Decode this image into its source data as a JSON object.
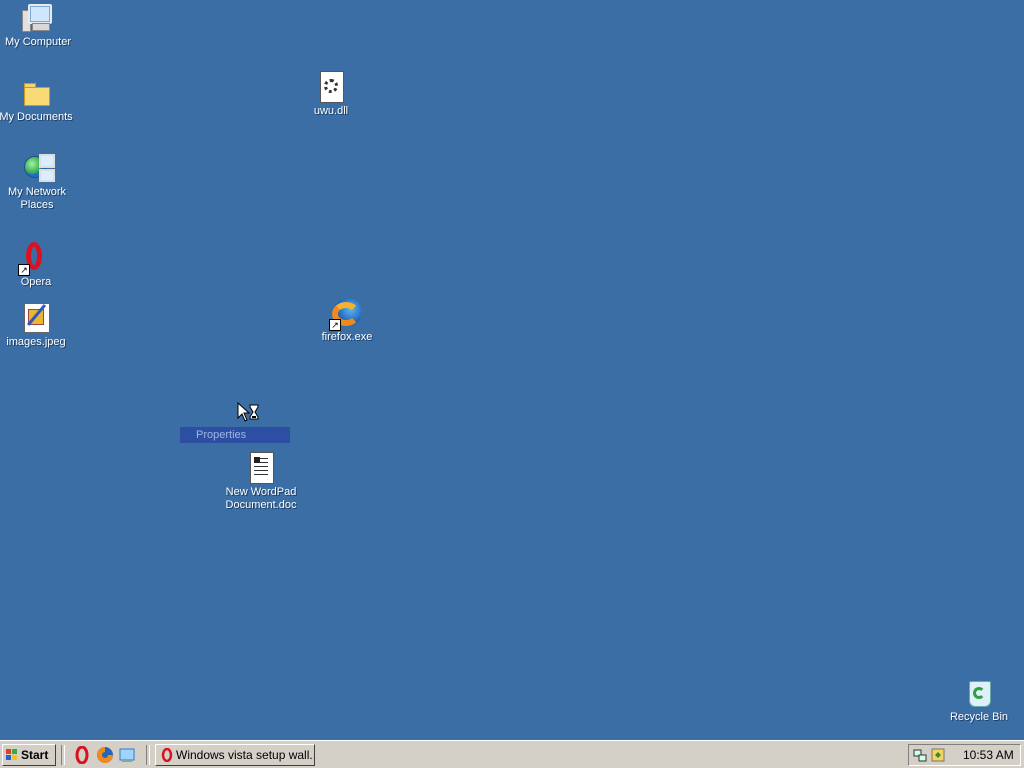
{
  "desktop": {
    "background": "#3a6ea5",
    "icons": [
      {
        "name": "my-computer",
        "label": "My Computer",
        "icon": "computer-icon"
      },
      {
        "name": "my-documents",
        "label": "My Documents",
        "icon": "folder-icon"
      },
      {
        "name": "my-network-places",
        "label": "My Network Places",
        "icon": "network-places-icon"
      },
      {
        "name": "opera",
        "label": "Opera",
        "icon": "opera-icon",
        "shortcut": true
      },
      {
        "name": "images-jpeg",
        "label": "images.jpeg",
        "icon": "image-file-icon"
      },
      {
        "name": "uwu-dll",
        "label": "uwu.dll",
        "icon": "dll-file-icon"
      },
      {
        "name": "firefox-exe",
        "label": "firefox.exe",
        "icon": "firefox-icon",
        "shortcut": true
      },
      {
        "name": "new-wordpad-document",
        "label": "New WordPad Document.doc",
        "icon": "wordpad-document-icon"
      },
      {
        "name": "recycle-bin",
        "label": "Recycle Bin",
        "icon": "recycle-bin-icon"
      }
    ],
    "context_menu_item": "Properties",
    "shortcut_arrow": "↗"
  },
  "taskbar": {
    "start_label": "Start",
    "quick_launch": [
      "opera-icon",
      "firefox-icon",
      "show-desktop-icon"
    ],
    "task_button_label": "Windows vista setup wall...",
    "clock": "10:53 AM",
    "tray_icons": [
      "network-icon",
      "update-icon"
    ]
  }
}
